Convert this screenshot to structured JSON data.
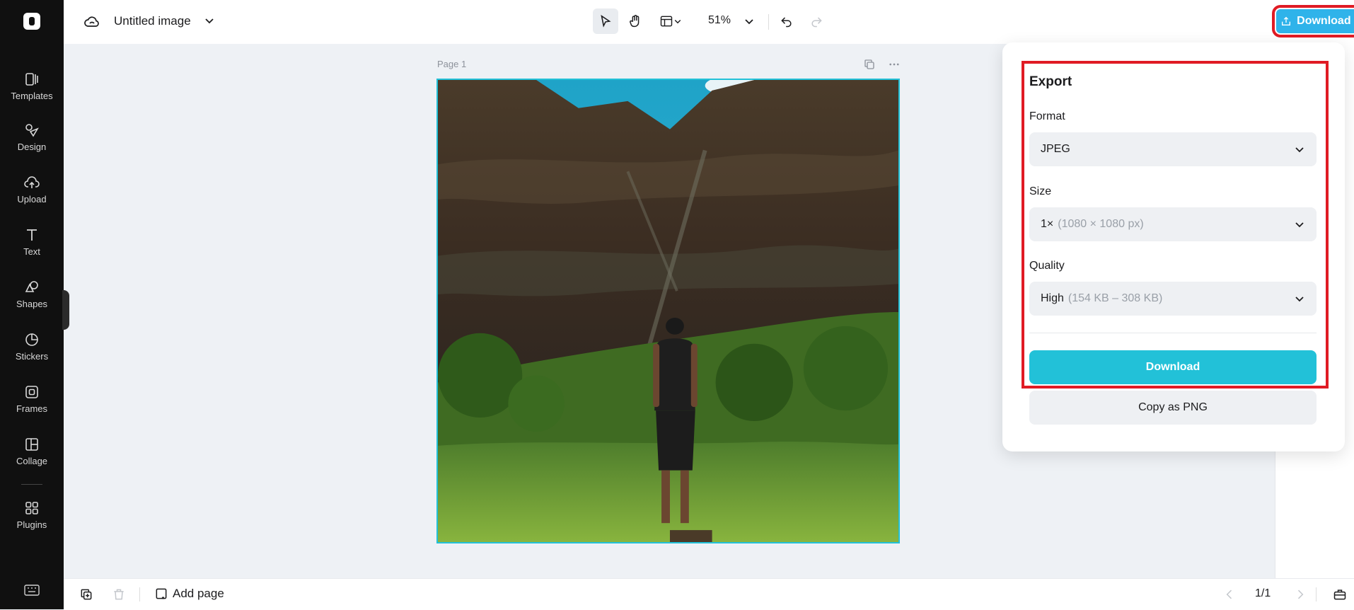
{
  "sidebar": {
    "items": [
      {
        "label": "Templates",
        "icon": "templates-icon"
      },
      {
        "label": "Design",
        "icon": "design-icon"
      },
      {
        "label": "Upload",
        "icon": "upload-icon"
      },
      {
        "label": "Text",
        "icon": "text-icon"
      },
      {
        "label": "Shapes",
        "icon": "shapes-icon"
      },
      {
        "label": "Stickers",
        "icon": "stickers-icon"
      },
      {
        "label": "Frames",
        "icon": "frames-icon"
      },
      {
        "label": "Collage",
        "icon": "collage-icon"
      },
      {
        "label": "Plugins",
        "icon": "plugins-icon"
      }
    ]
  },
  "header": {
    "title": "Untitled image",
    "zoom": "51%",
    "download_all_label": "Download all"
  },
  "canvas": {
    "page_label": "Page 1"
  },
  "export_panel": {
    "title": "Export",
    "format_label": "Format",
    "format_value": "JPEG",
    "size_label": "Size",
    "size_value": "1×",
    "size_detail": "(1080 × 1080 px)",
    "quality_label": "Quality",
    "quality_value": "High",
    "quality_detail": "(154 KB – 308 KB)",
    "download_label": "Download",
    "copy_label": "Copy as PNG"
  },
  "bottombar": {
    "add_page_label": "Add page",
    "pager": "1/1"
  },
  "colors": {
    "accent": "#22c1d8",
    "download_all": "#2fb3ea",
    "highlight": "#e01b24",
    "sidebar": "#101010"
  }
}
